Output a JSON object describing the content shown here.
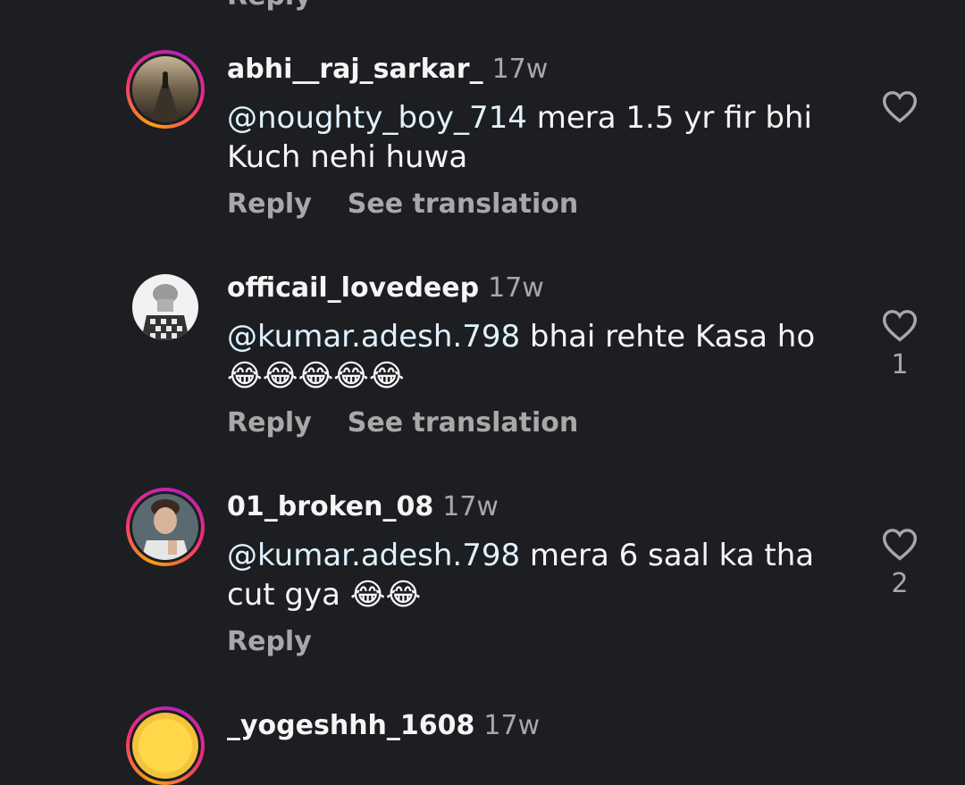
{
  "top_fragment": "Reply",
  "comments": [
    {
      "username": "abhi__raj_sarkar_",
      "age": "17w",
      "mention": "@noughty_boy_714",
      "text": " mera 1.5 yr fir bhi Kuch nehi huwa",
      "reply_label": "Reply",
      "translate_label": "See translation",
      "likes": ""
    },
    {
      "username": "officail_lovedeep",
      "age": "17w",
      "mention": "@kumar.adesh.798",
      "text": " bhai rehte Kasa ho 😂😂😂😂😂",
      "reply_label": "Reply",
      "translate_label": "See translation",
      "likes": "1"
    },
    {
      "username": "01_broken_08",
      "age": "17w",
      "mention": "@kumar.adesh.798",
      "text": " mera 6 saal ka tha cut gya 😂😂",
      "reply_label": "Reply",
      "likes": "2"
    },
    {
      "username": "_yogeshhh_1608",
      "age": "17w"
    }
  ]
}
